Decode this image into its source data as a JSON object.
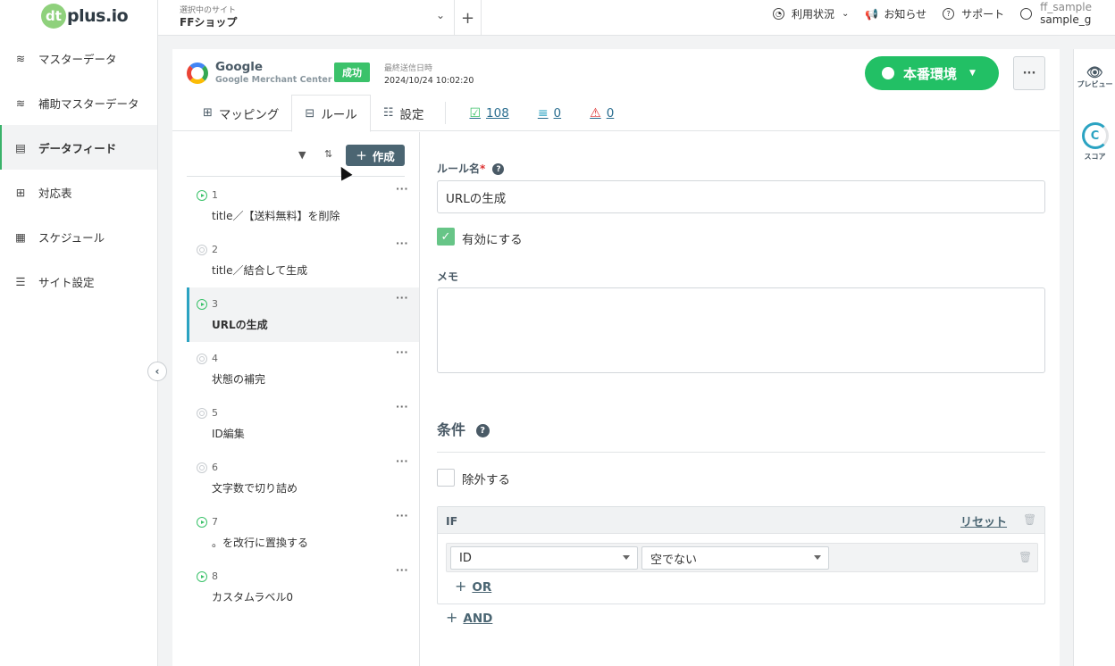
{
  "logo": {
    "mark": "dt",
    "text": "plus.io"
  },
  "sidebar": {
    "items": [
      {
        "label": "マスターデータ",
        "icon": "database-icon",
        "glyph": "≋"
      },
      {
        "label": "補助マスターデータ",
        "icon": "database-add-icon",
        "glyph": "≋"
      },
      {
        "label": "データフィード",
        "icon": "document-icon",
        "glyph": "▤"
      },
      {
        "label": "対応表",
        "icon": "table-icon",
        "glyph": "⊞"
      },
      {
        "label": "スケジュール",
        "icon": "calendar-clock-icon",
        "glyph": "▦"
      },
      {
        "label": "サイト設定",
        "icon": "sliders-icon",
        "glyph": "☰"
      }
    ],
    "active_index": 2
  },
  "topbar": {
    "site_label": "選択中のサイト",
    "site_name": "FFショップ",
    "add": "+",
    "usage": "利用状況",
    "news": "お知らせ",
    "support": "サポート",
    "user_top": "ff_sample",
    "user_bottom": "sample_g"
  },
  "channel": {
    "name": "Google",
    "sub": "Google Merchant Center",
    "status": "成功",
    "last_sent_label": "最終送信日時",
    "last_sent_value": "2024/10/24 10:02:20",
    "env_button": "本番環境",
    "more": "···"
  },
  "tabs": [
    {
      "label": "マッピング",
      "glyph": "⊞"
    },
    {
      "label": "ルール",
      "glyph": "⊟"
    },
    {
      "label": "設定",
      "glyph": "☷"
    }
  ],
  "stats": {
    "ok": "108",
    "excluded": "0",
    "errors": "0"
  },
  "rule_list": {
    "create": "作成",
    "create_plus": "+",
    "rules": [
      {
        "num": "1",
        "name": "title／【送料無料】を削除",
        "enabled": true
      },
      {
        "num": "2",
        "name": "title／結合して生成",
        "enabled": false
      },
      {
        "num": "3",
        "name": "URLの生成",
        "enabled": true
      },
      {
        "num": "4",
        "name": "状態の補完",
        "enabled": false
      },
      {
        "num": "5",
        "name": "ID編集",
        "enabled": false
      },
      {
        "num": "6",
        "name": "文字数で切り詰め",
        "enabled": false
      },
      {
        "num": "7",
        "name": "。を改行に置換する",
        "enabled": true
      },
      {
        "num": "8",
        "name": "カスタムラベル0",
        "enabled": true
      }
    ],
    "selected_index": 2,
    "dots": "···"
  },
  "form": {
    "rule_name_label": "ルール名",
    "required_mark": "*",
    "rule_name_value": "URLの生成",
    "enable_label": "有効にする",
    "memo_label": "メモ",
    "memo_value": "",
    "conditions_title": "条件",
    "exclude_label": "除外する",
    "if_label": "IF",
    "reset": "リセット",
    "field_value": "ID",
    "operator_value": "空でない",
    "or": "OR",
    "and": "AND",
    "plus": "+"
  },
  "rail": {
    "preview": "プレビュー",
    "score": "スコア"
  },
  "colors": {
    "accent_green": "#22c065",
    "status_green": "#3bc26a",
    "slate": "#4a5a66",
    "link": "#2a6d8f",
    "error_red": "#d33"
  }
}
